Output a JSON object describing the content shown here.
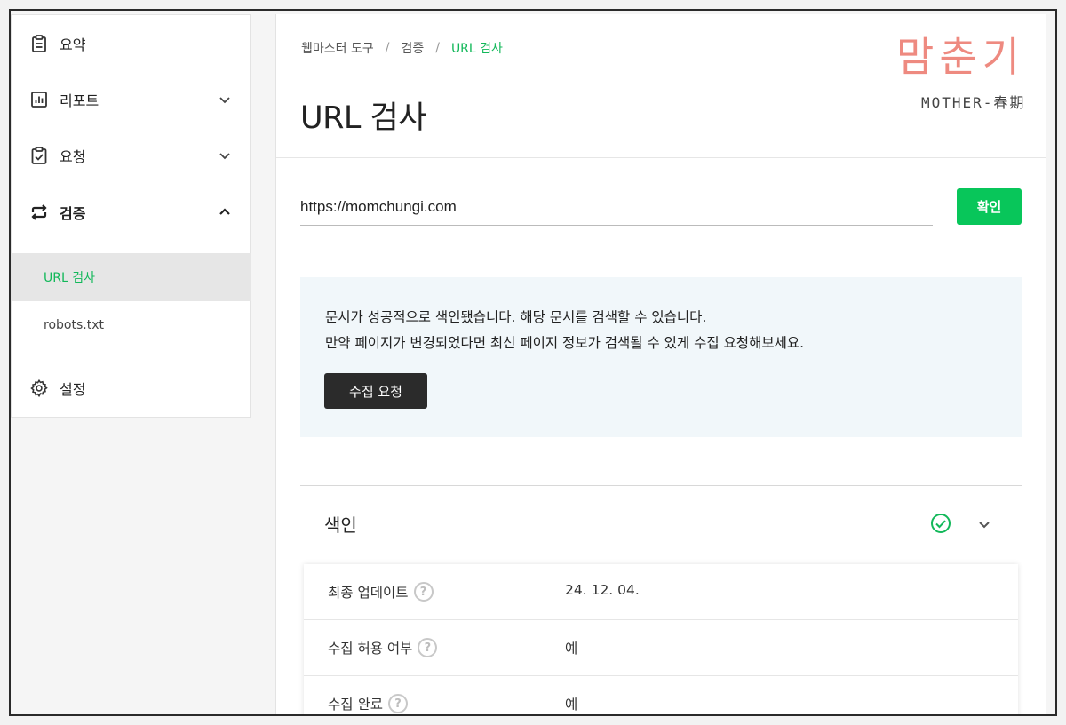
{
  "sidebar": {
    "items": [
      {
        "label": "요약",
        "icon": "clipboard-icon"
      },
      {
        "label": "리포트",
        "icon": "bar-chart-icon"
      },
      {
        "label": "요청",
        "icon": "clipboard-check-icon"
      },
      {
        "label": "검증",
        "icon": "swap-arrows-icon"
      },
      {
        "label": "설정",
        "icon": "gear-icon"
      }
    ],
    "sub_items": [
      {
        "label": "URL 검사",
        "active": true
      },
      {
        "label": "robots.txt",
        "active": false
      }
    ]
  },
  "breadcrumb": {
    "items": [
      "웹마스터 도구",
      "검증",
      "URL 검사"
    ],
    "separator": "/"
  },
  "page_title": "URL 검사",
  "logo": {
    "korean": "맘춘기",
    "english": "MOTHER-春期"
  },
  "url_field": {
    "value": "https://momchungi.com"
  },
  "confirm_button": "확인",
  "notice": {
    "line1": "문서가 성공적으로 색인됐습니다. 해당 문서를 검색할 수 있습니다.",
    "line2": "만약 페이지가 변경되었다면 최신 페이지 정보가 검색될 수 있게 수집 요청해보세요.",
    "button": "수집 요청"
  },
  "index_section": {
    "title": "색인",
    "rows": [
      {
        "label": "최종 업데이트",
        "value": "24. 12. 04."
      },
      {
        "label": "수집 허용 여부",
        "value": "예"
      },
      {
        "label": "수집 완료",
        "value": "예"
      }
    ],
    "help_glyph": "?"
  },
  "colors": {
    "accent_green": "#13b85a",
    "button_green": "#08c65a",
    "dark_button": "#2b2b2b",
    "notice_bg": "#f1f7fa",
    "logo_pink": "#ee8a80"
  }
}
